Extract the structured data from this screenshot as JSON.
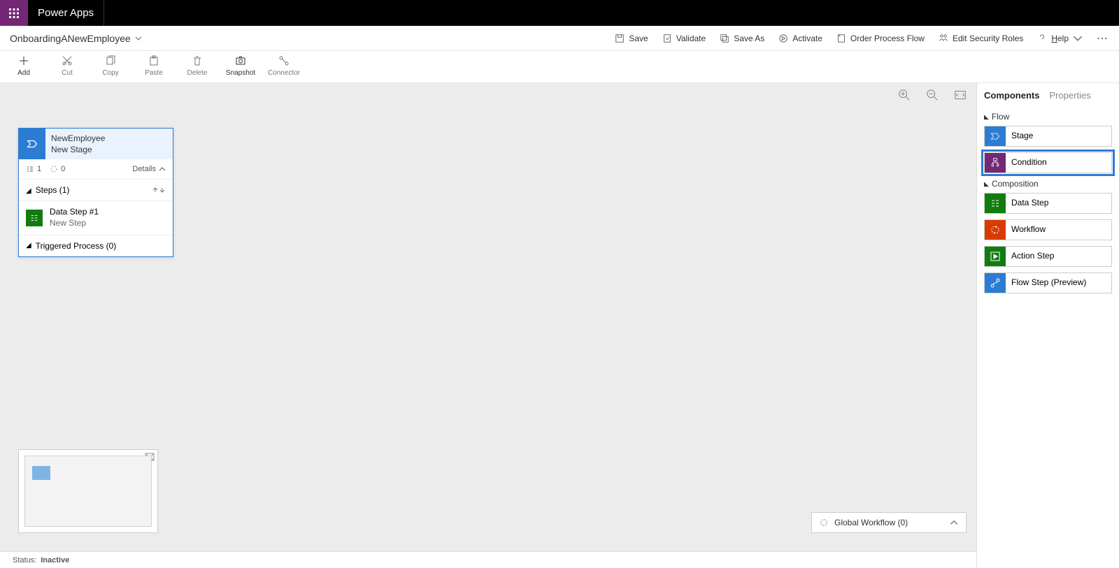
{
  "app": {
    "brand": "Power Apps"
  },
  "flow": {
    "name": "OnboardingANewEmployee"
  },
  "cmdbar": {
    "save": "Save",
    "validate": "Validate",
    "saveas": "Save As",
    "activate": "Activate",
    "order": "Order Process Flow",
    "security": "Edit Security Roles",
    "help": "Help"
  },
  "toolbar": {
    "add": "Add",
    "cut": "Cut",
    "copy": "Copy",
    "paste": "Paste",
    "delete": "Delete",
    "snapshot": "Snapshot",
    "connector": "Connector"
  },
  "stage": {
    "name": "NewEmployee",
    "subtitle": "New Stage",
    "steps_count": "1",
    "wf_count": "0",
    "details_label": "Details",
    "steps_label": "Steps (1)",
    "step1_title": "Data Step #1",
    "step1_sub": "New Step",
    "triggered_label": "Triggered Process (0)"
  },
  "globalwf": {
    "label": "Global Workflow (0)"
  },
  "panel": {
    "tab_components": "Components",
    "tab_properties": "Properties",
    "sec_flow": "Flow",
    "sec_composition": "Composition",
    "stage": "Stage",
    "condition": "Condition",
    "datastep": "Data Step",
    "workflow": "Workflow",
    "actionstep": "Action Step",
    "flowstep": "Flow Step (Preview)"
  },
  "status": {
    "label": "Status:",
    "value": "Inactive"
  }
}
